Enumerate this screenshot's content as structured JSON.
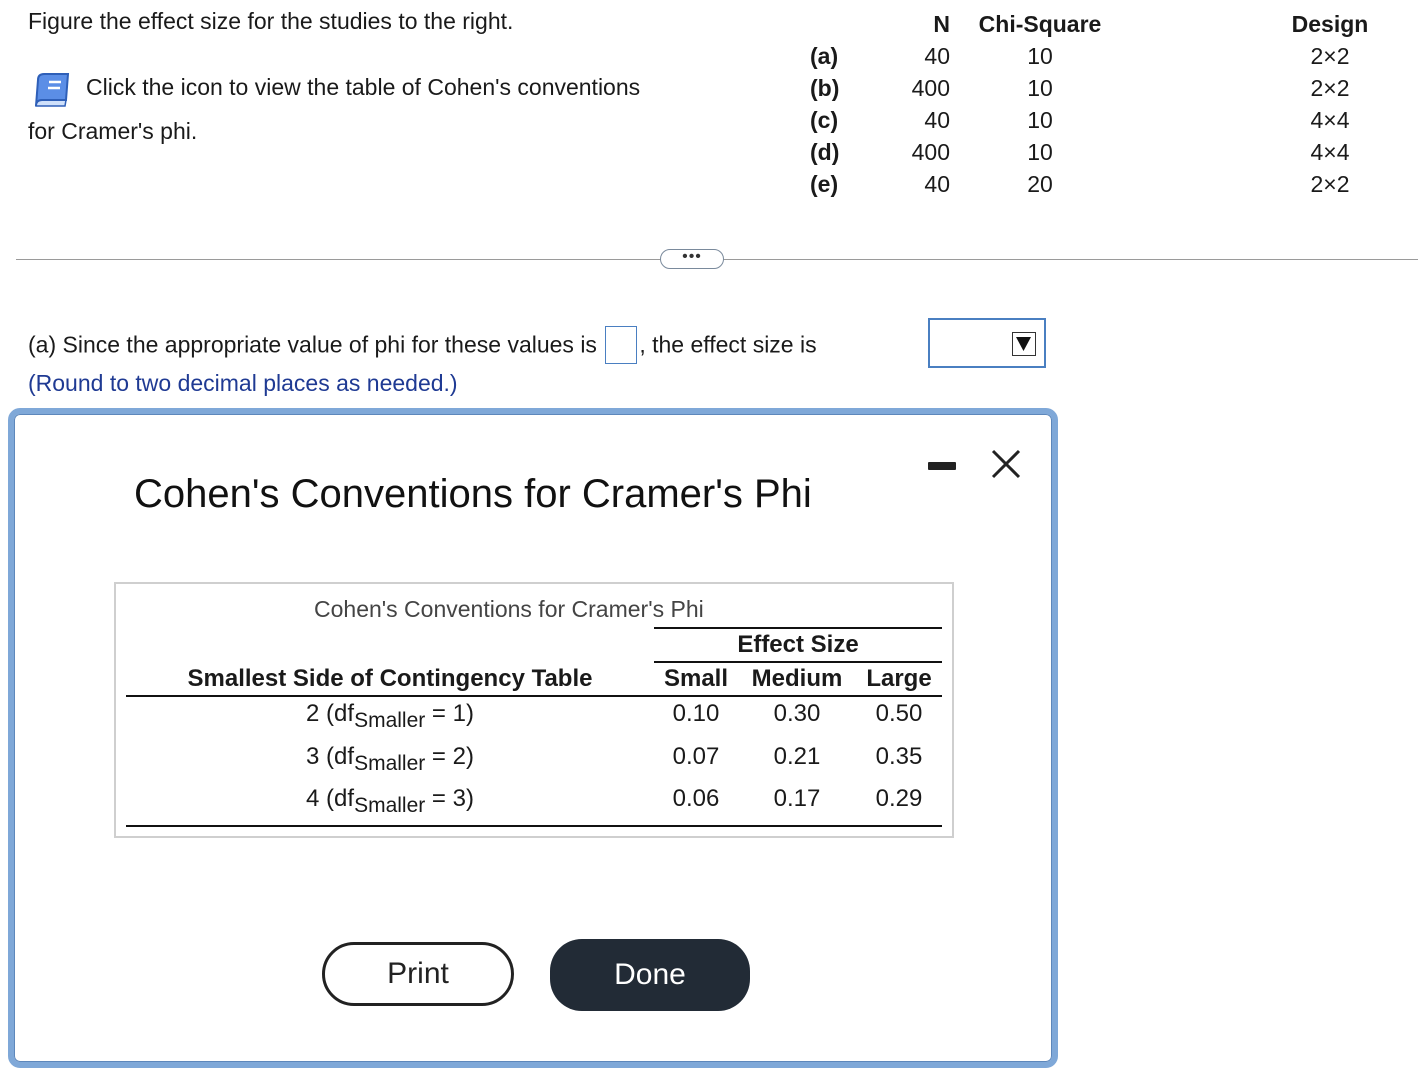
{
  "prompt": {
    "instruction": "Figure the effect size for the studies to the right.",
    "help_line1": "Click the icon to view the table of Cohen's conventions",
    "help_line2": "for Cramer's phi."
  },
  "studies": {
    "headers": {
      "label": "",
      "n": "N",
      "chi": "Chi-Square",
      "design": "Design"
    },
    "rows": [
      {
        "label": "(a)",
        "n": "40",
        "chi": "10",
        "design": "2×2"
      },
      {
        "label": "(b)",
        "n": "400",
        "chi": "10",
        "design": "2×2"
      },
      {
        "label": "(c)",
        "n": "40",
        "chi": "10",
        "design": "4×4"
      },
      {
        "label": "(d)",
        "n": "400",
        "chi": "10",
        "design": "4×4"
      },
      {
        "label": "(e)",
        "n": "40",
        "chi": "20",
        "design": "2×2"
      }
    ]
  },
  "more_button": {
    "label": "•••"
  },
  "question": {
    "part_a_before": "(a) Since the appropriate value of phi for these values is",
    "part_a_middle": ", the effect size is",
    "phi_value": "",
    "effect_selected": "",
    "round_note": "(Round to two decimal places as needed.)"
  },
  "dialog": {
    "title": "Cohen's Conventions for Cramer's Phi",
    "table": {
      "caption": "Cohen's Conventions for Cramer's Phi",
      "group_header": "Effect Size",
      "row_header": "Smallest Side of Contingency Table",
      "columns": [
        "Small",
        "Medium",
        "Large"
      ],
      "rows": [
        {
          "side": "2 (df",
          "sub": "Smaller",
          "after": " = 1)",
          "values": [
            "0.10",
            "0.30",
            "0.50"
          ]
        },
        {
          "side": "3 (df",
          "sub": "Smaller",
          "after": " = 2)",
          "values": [
            "0.07",
            "0.21",
            "0.35"
          ]
        },
        {
          "side": "4 (df",
          "sub": "Smaller",
          "after": " = 3)",
          "values": [
            "0.06",
            "0.17",
            "0.29"
          ]
        }
      ]
    },
    "print_label": "Print",
    "done_label": "Done"
  },
  "colors": {
    "accent": "#4a7fc1",
    "note_text": "#1f3a93",
    "dialog_border": "#7fa8d8",
    "done_button": "#222b36"
  }
}
